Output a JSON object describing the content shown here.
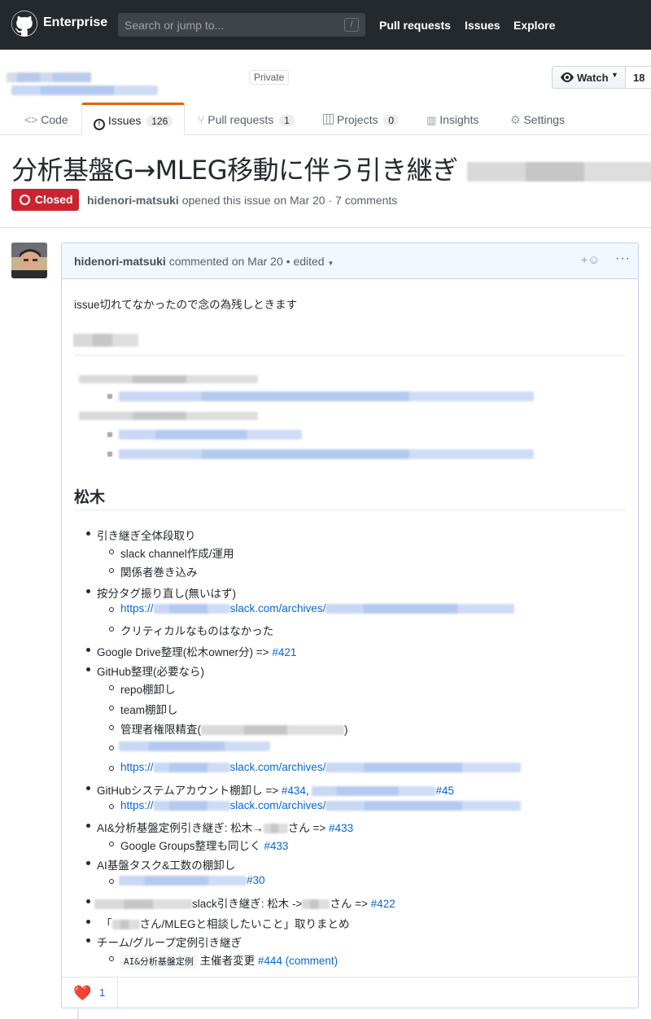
{
  "header": {
    "brand": "Enterprise",
    "search_placeholder": "Search or jump to...",
    "slash_key": "/",
    "nav": [
      "Pull requests",
      "Issues",
      "Explore"
    ]
  },
  "repo": {
    "visibility": "Private",
    "watch_label": "Watch",
    "watch_count": "18"
  },
  "tabs": [
    {
      "label": "Code",
      "icon": "code-icon"
    },
    {
      "label": "Issues",
      "count": "126",
      "icon": "issue-icon"
    },
    {
      "label": "Pull requests",
      "count": "1",
      "icon": "pull-request-icon"
    },
    {
      "label": "Projects",
      "count": "0",
      "icon": "project-icon"
    },
    {
      "label": "Insights",
      "icon": "graph-icon"
    },
    {
      "label": "Settings",
      "icon": "gear-icon"
    }
  ],
  "issue": {
    "title": "分析基盤G→MLEG移動に伴う引き継ぎ",
    "state": "Closed",
    "author": "hidenori-matsuki",
    "meta_text": "opened this issue on Mar 20 · 7 comments"
  },
  "comment": {
    "author": "hidenori-matsuki",
    "meta": "commented on Mar 20 •",
    "edited": "edited",
    "intro": "issue切れてなかったので念の為残しときます",
    "section_title": "松木",
    "items": {
      "i1": "引き継ぎ全体段取り",
      "i1a": "slack channel作成/運用",
      "i1b": "関係者巻き込み",
      "i2": "按分タグ振り直し(無いはず)",
      "i2a_prefix": "https://",
      "i2a_mid": "slack.com/archives/",
      "i2b": "クリティカルなものはなかった",
      "i3": "Google Drive整理(松木owner分) => ",
      "i3_link": "#421",
      "i4": "GitHub整理(必要なら)",
      "i4a": "repo棚卸し",
      "i4b": "team棚卸し",
      "i4c": "管理者権限精査(",
      "i4c_end": ")",
      "i4e_prefix": "https://",
      "i4e_mid": "slack.com/archives/",
      "i5": "GitHubシステムアカウント棚卸し => ",
      "i5_link": "#434",
      "i5_sep": ", ",
      "i5_link2": "#45",
      "i5a_prefix": "https://",
      "i5a_mid": "slack.com/archives/",
      "i6": "AI&分析基盤定例引き継ぎ: 松木→",
      "i6_end": "さん => ",
      "i6_link": "#433",
      "i6a": "Google Groups整理も同じく ",
      "i6a_link": "#433",
      "i7": "AI基盤タスク&工数の棚卸し",
      "i7a_link": "#30",
      "i8": "slack引き継ぎ: 松木 ->",
      "i8_end": "さん => ",
      "i8_link": "#422",
      "i9_start": "「",
      "i9": "さん/MLEGと相談したいこと」取りまとめ",
      "i10": "チーム/グループ定例引き継ぎ",
      "i10a_code": "AI&分析基盤定例",
      "i10a": " 主催者変更 ",
      "i10a_link": "#444 (comment)"
    },
    "reaction_emoji": "❤️",
    "reaction_count": "1"
  }
}
